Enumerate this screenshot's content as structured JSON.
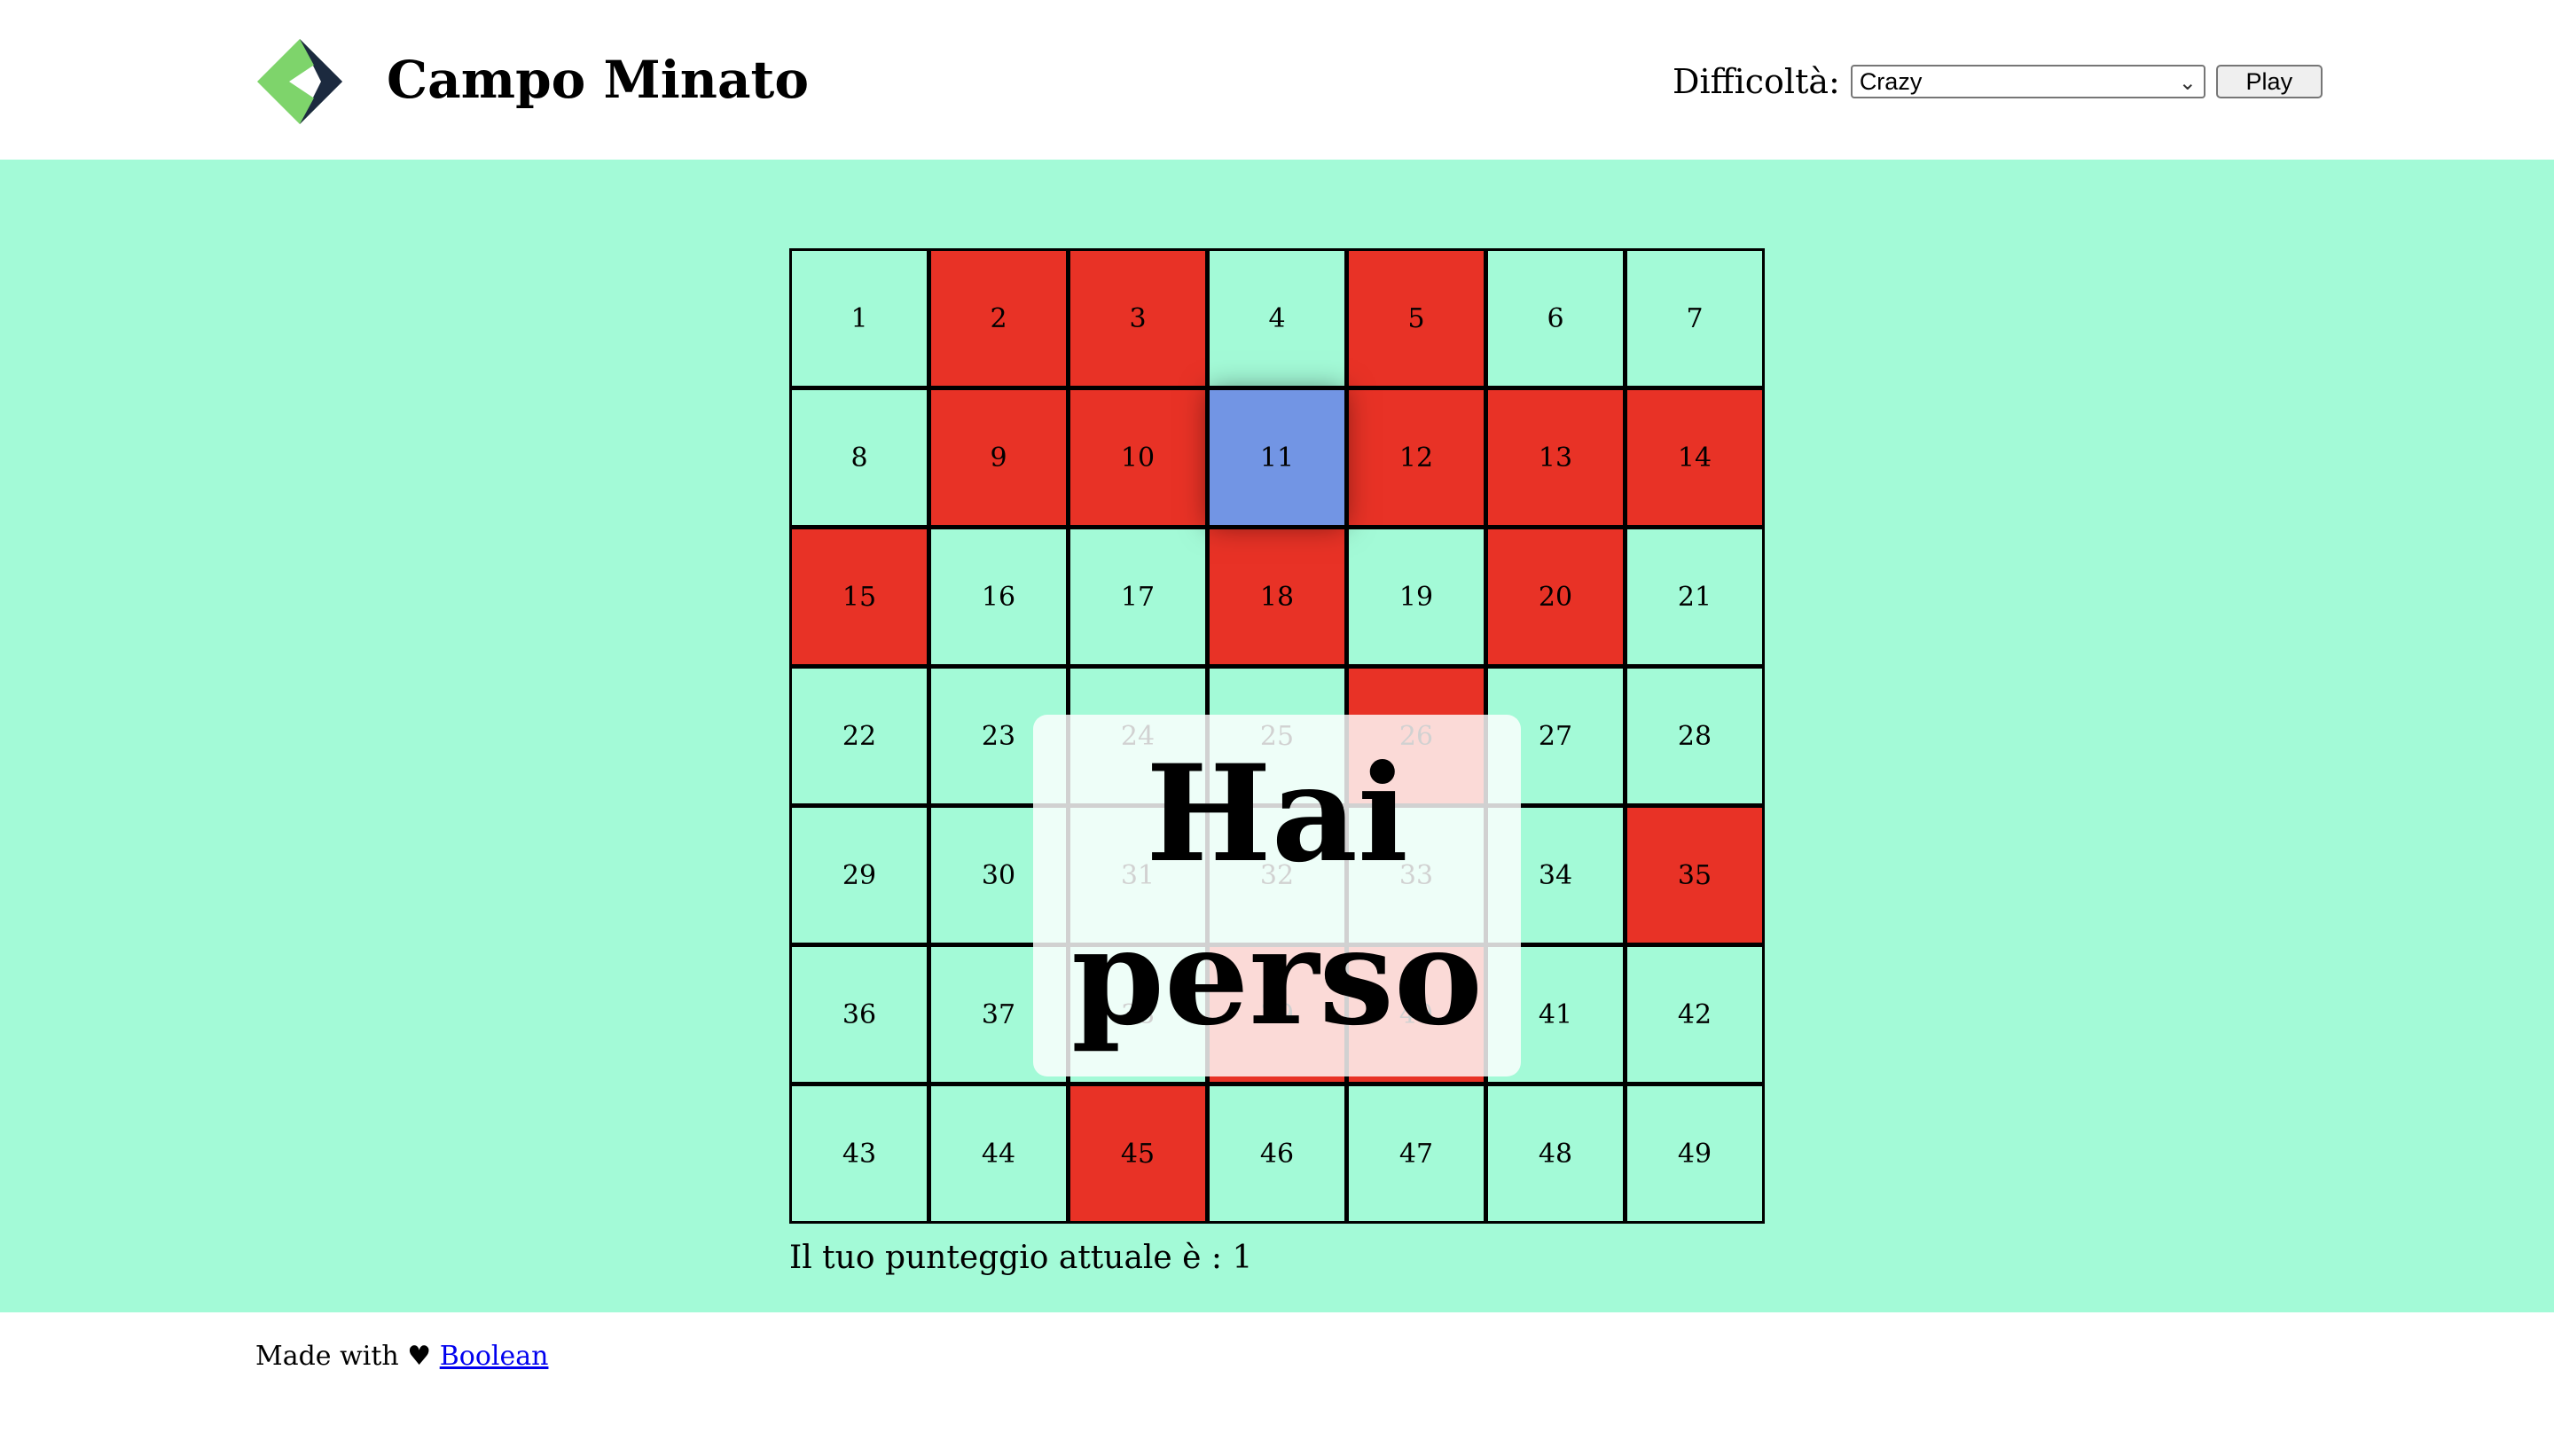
{
  "header": {
    "title": "Campo Minato",
    "difficulty_label": "Difficoltà:",
    "difficulty_selected": "Crazy",
    "play_label": "Play"
  },
  "grid": {
    "rows": 7,
    "cols": 7,
    "cells": [
      {
        "n": "1",
        "state": "safe"
      },
      {
        "n": "2",
        "state": "bomb"
      },
      {
        "n": "3",
        "state": "bomb"
      },
      {
        "n": "4",
        "state": "safe"
      },
      {
        "n": "5",
        "state": "bomb"
      },
      {
        "n": "6",
        "state": "safe"
      },
      {
        "n": "7",
        "state": "safe"
      },
      {
        "n": "8",
        "state": "safe"
      },
      {
        "n": "9",
        "state": "bomb"
      },
      {
        "n": "10",
        "state": "bomb"
      },
      {
        "n": "11",
        "state": "clicked"
      },
      {
        "n": "12",
        "state": "bomb"
      },
      {
        "n": "13",
        "state": "bomb"
      },
      {
        "n": "14",
        "state": "bomb"
      },
      {
        "n": "15",
        "state": "bomb"
      },
      {
        "n": "16",
        "state": "safe"
      },
      {
        "n": "17",
        "state": "safe"
      },
      {
        "n": "18",
        "state": "bomb"
      },
      {
        "n": "19",
        "state": "safe"
      },
      {
        "n": "20",
        "state": "bomb"
      },
      {
        "n": "21",
        "state": "safe"
      },
      {
        "n": "22",
        "state": "safe"
      },
      {
        "n": "23",
        "state": "safe"
      },
      {
        "n": "24",
        "state": "safe"
      },
      {
        "n": "25",
        "state": "safe"
      },
      {
        "n": "26",
        "state": "bomb"
      },
      {
        "n": "27",
        "state": "safe"
      },
      {
        "n": "28",
        "state": "safe"
      },
      {
        "n": "29",
        "state": "safe"
      },
      {
        "n": "30",
        "state": "safe"
      },
      {
        "n": "31",
        "state": "safe"
      },
      {
        "n": "32",
        "state": "safe"
      },
      {
        "n": "33",
        "state": "safe"
      },
      {
        "n": "34",
        "state": "safe"
      },
      {
        "n": "35",
        "state": "bomb"
      },
      {
        "n": "36",
        "state": "safe"
      },
      {
        "n": "37",
        "state": "safe"
      },
      {
        "n": "38",
        "state": "safe"
      },
      {
        "n": "39",
        "state": "bomb"
      },
      {
        "n": "40",
        "state": "bomb"
      },
      {
        "n": "41",
        "state": "safe"
      },
      {
        "n": "42",
        "state": "safe"
      },
      {
        "n": "43",
        "state": "safe"
      },
      {
        "n": "44",
        "state": "safe"
      },
      {
        "n": "45",
        "state": "bomb"
      },
      {
        "n": "46",
        "state": "safe"
      },
      {
        "n": "47",
        "state": "safe"
      },
      {
        "n": "48",
        "state": "safe"
      },
      {
        "n": "49",
        "state": "safe"
      }
    ]
  },
  "overlay": {
    "message": "Hai perso"
  },
  "score": {
    "text": "Il tuo punteggio attuale è : 1"
  },
  "footer": {
    "made_with": "Made with ♥",
    "link_text": "Boolean"
  },
  "colors": {
    "safe": "#a3fad7",
    "bomb": "#e83226",
    "clicked": "#7295e4",
    "logo_green": "#7ed46b",
    "logo_navy": "#1c2a3f"
  }
}
